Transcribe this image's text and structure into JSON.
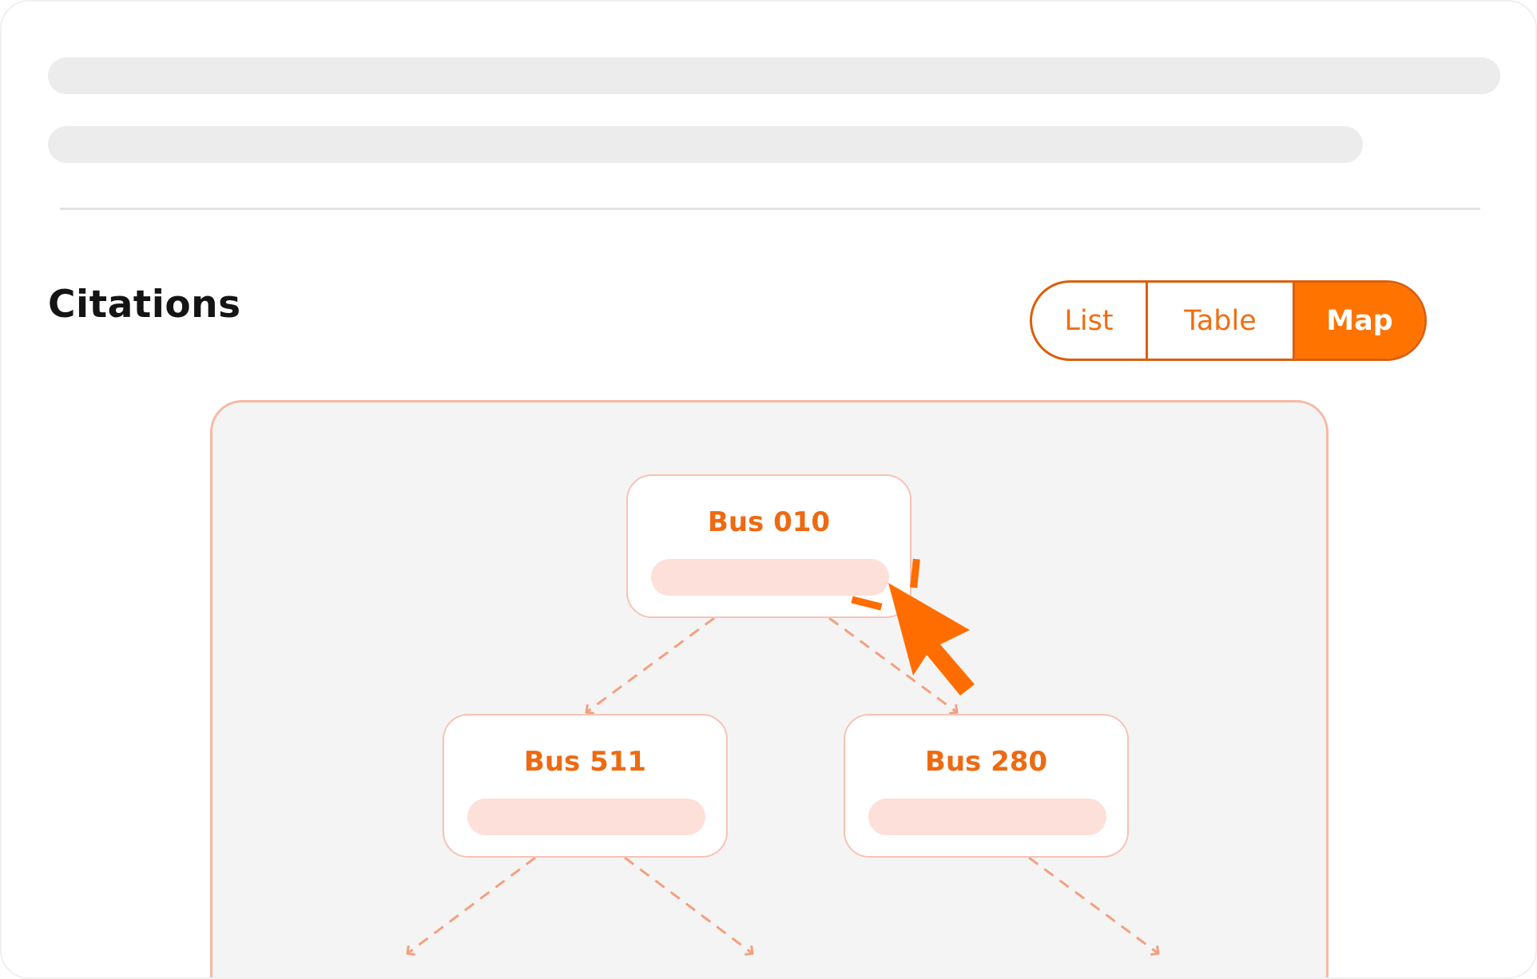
{
  "section": {
    "title": "Citations"
  },
  "view_toggle": {
    "options": [
      {
        "label": "List",
        "selected": false
      },
      {
        "label": "Table",
        "selected": false
      },
      {
        "label": "Map",
        "selected": true
      }
    ]
  },
  "map": {
    "nodes": [
      {
        "label": "Bus 010"
      },
      {
        "label": "Bus 511"
      },
      {
        "label": "Bus 280"
      }
    ]
  },
  "colors": {
    "accent": "#ff7400",
    "node_text": "#ee6a12",
    "edge": "#f3a07f",
    "panel_border": "#f7b9a6",
    "bar": "#fde0da"
  },
  "cursor": {
    "icon": "pointer-cursor-icon"
  }
}
